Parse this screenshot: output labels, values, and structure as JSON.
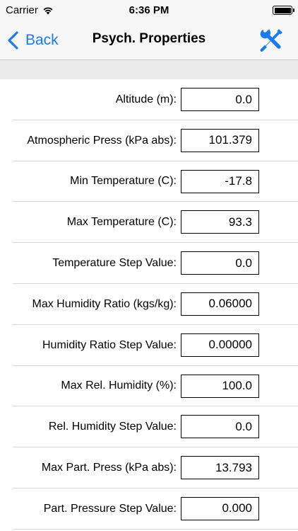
{
  "status_bar": {
    "carrier": "Carrier",
    "time": "6:36 PM",
    "wifi_icon": "wifi-icon",
    "battery_icon": "battery-icon"
  },
  "nav": {
    "back_label": "Back",
    "title": "Psych. Properties",
    "tools_icon": "tools-icon",
    "accent_color": "#1a7cf0"
  },
  "fields": [
    {
      "label": "Altitude (m):",
      "value": "0.0"
    },
    {
      "label": "Atmospheric Press (kPa abs):",
      "value": "101.379"
    },
    {
      "label": "Min Temperature (C):",
      "value": "-17.8"
    },
    {
      "label": "Max Temperature (C):",
      "value": "93.3"
    },
    {
      "label": "Temperature Step Value:",
      "value": "0.0"
    },
    {
      "label": "Max Humidity Ratio (kgs/kg):",
      "value": "0.06000"
    },
    {
      "label": "Humidity Ratio Step Value:",
      "value": "0.00000"
    },
    {
      "label": "Max Rel. Humidity (%):",
      "value": "100.0"
    },
    {
      "label": "Rel. Humidity Step Value:",
      "value": "0.0"
    },
    {
      "label": "Max Part. Press (kPa abs):",
      "value": "13.793"
    },
    {
      "label": "Part. Pressure Step Value:",
      "value": "0.000"
    }
  ]
}
